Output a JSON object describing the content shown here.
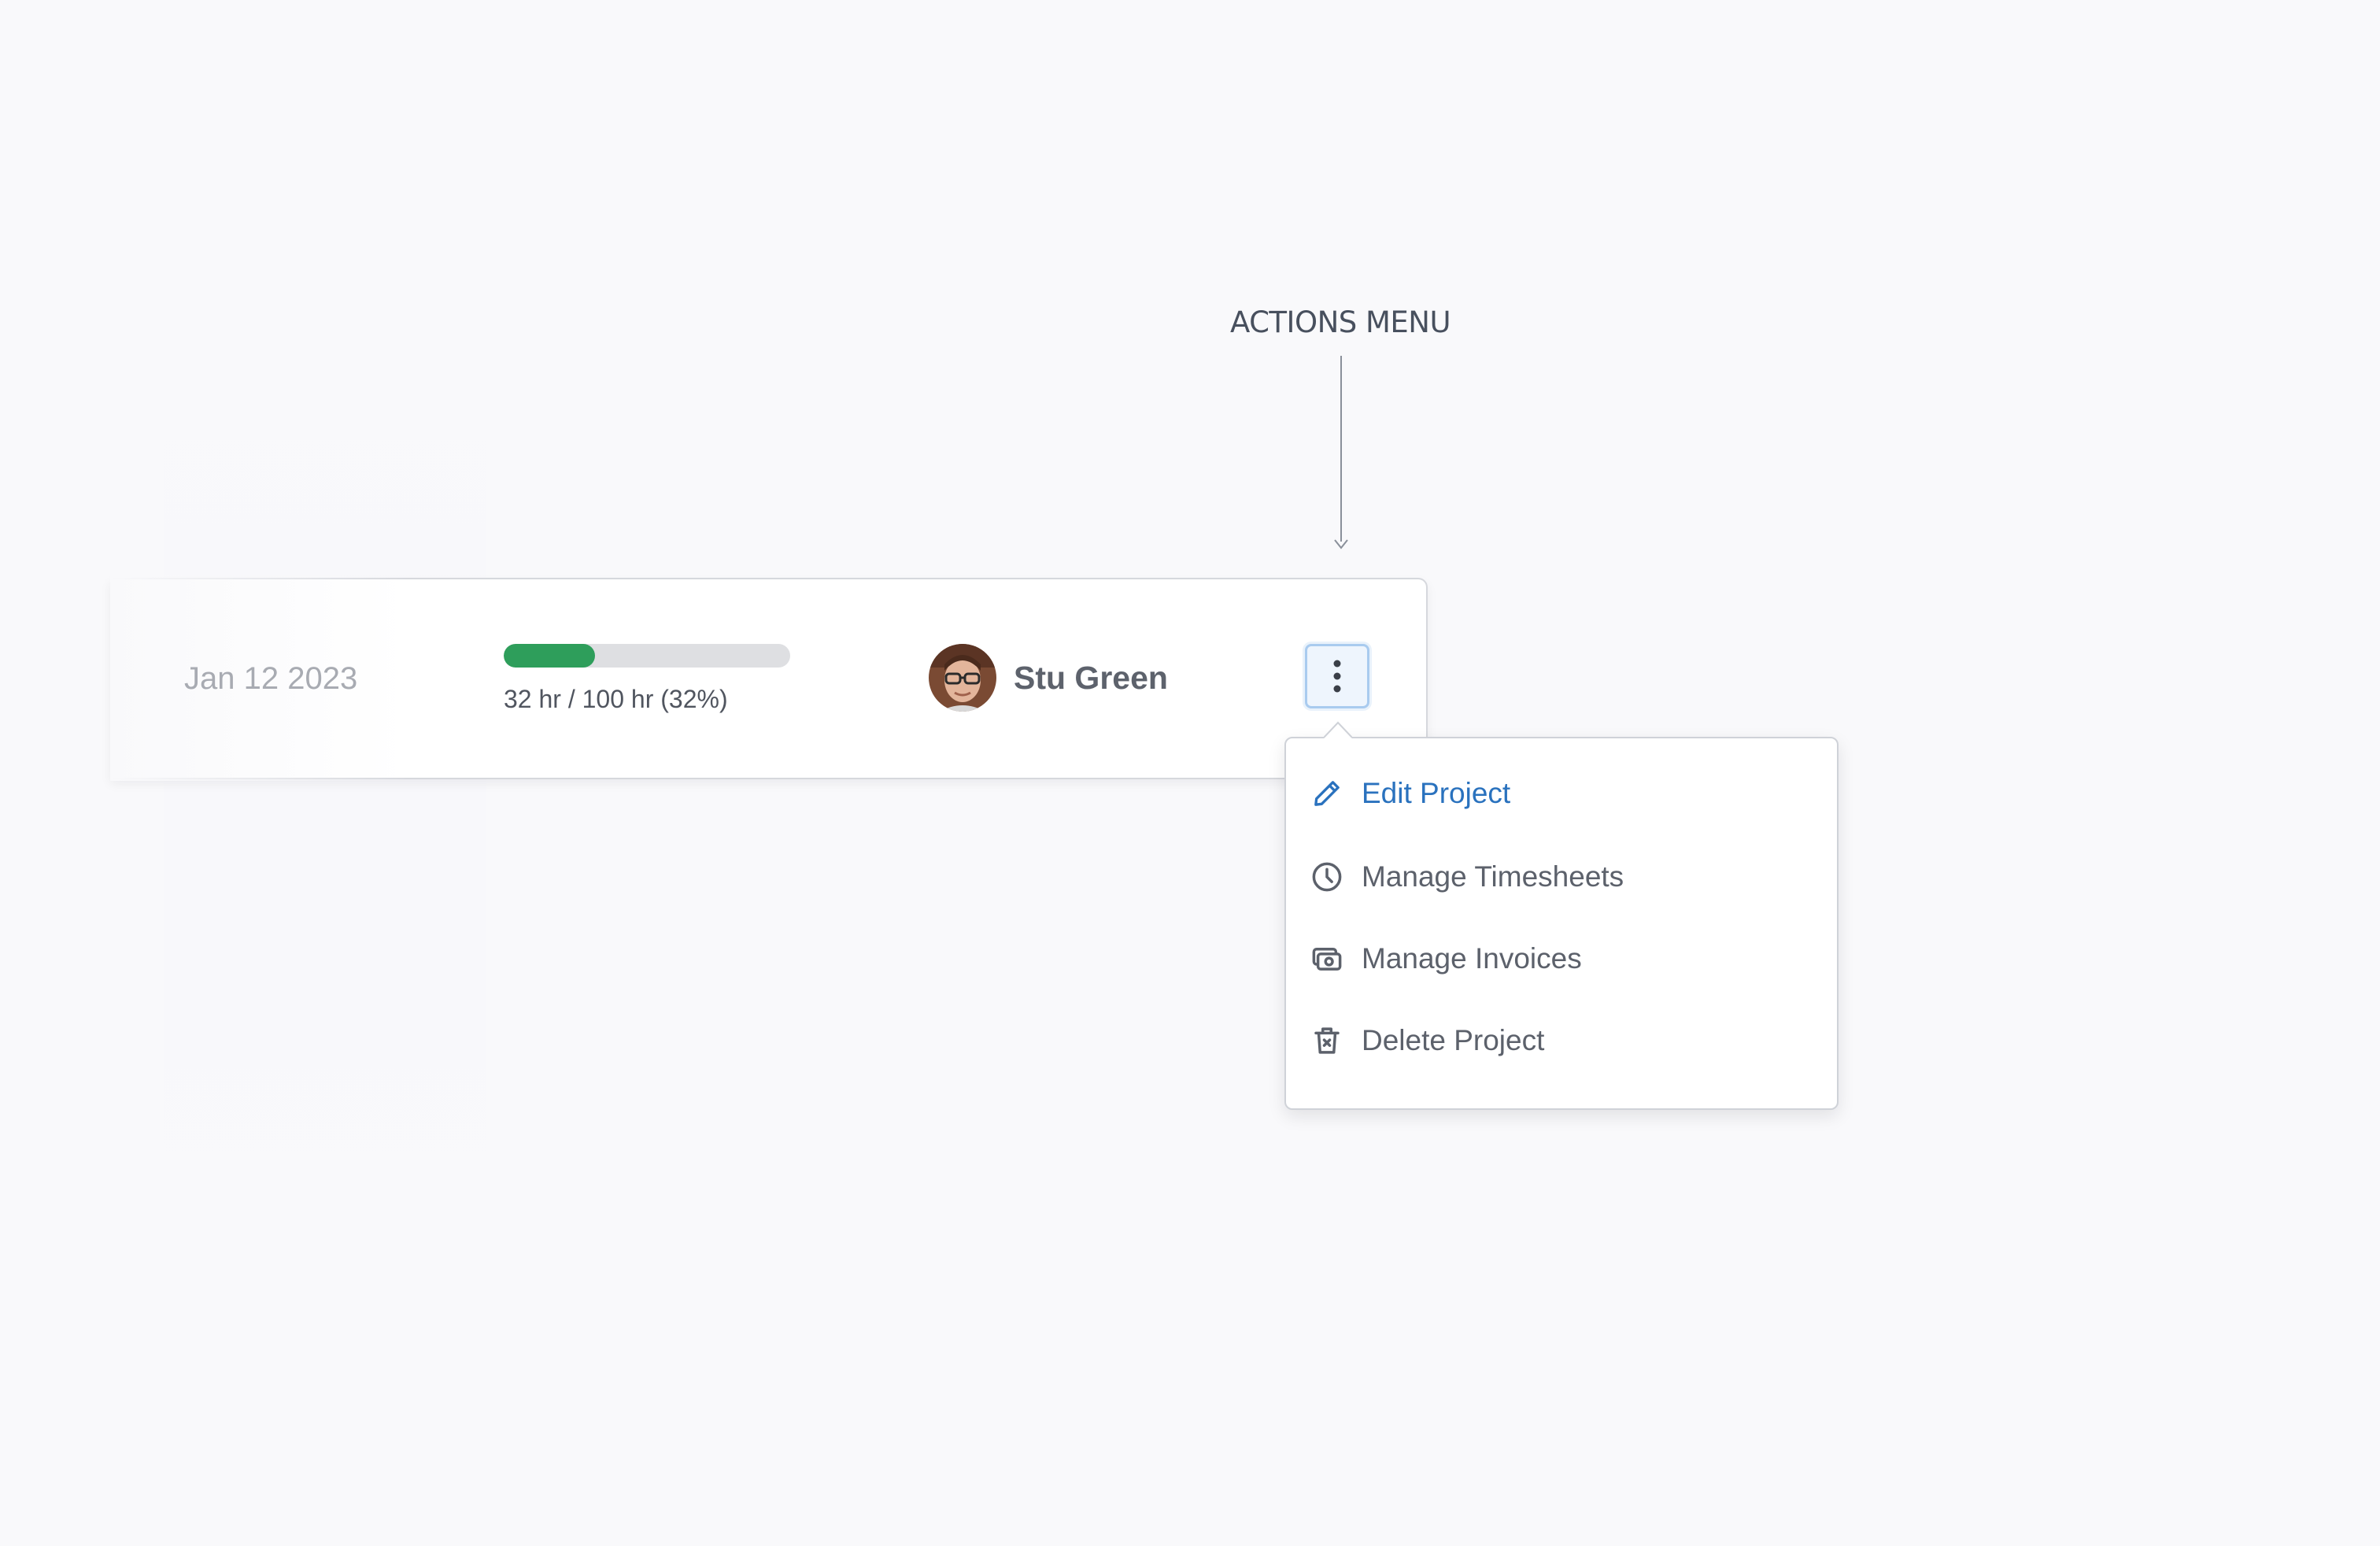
{
  "annotation": {
    "label": "ACTIONS MENU"
  },
  "row": {
    "date": "Jan 12 2023",
    "progress": {
      "hours_logged": 32,
      "hours_budget": 100,
      "percent": 32,
      "text": "32 hr / 100 hr (32%)"
    },
    "owner": {
      "name": "Stu Green",
      "avatar": "user-photo"
    },
    "actions_button_icon": "more-vertical-icon"
  },
  "actions_menu": {
    "items": [
      {
        "label": "Edit Project",
        "icon": "pencil-icon",
        "active": true
      },
      {
        "label": "Manage Timesheets",
        "icon": "clock-icon",
        "active": false
      },
      {
        "label": "Manage Invoices",
        "icon": "money-icon",
        "active": false
      },
      {
        "label": "Delete Project",
        "icon": "trash-icon",
        "active": false
      }
    ]
  },
  "colors": {
    "progress_fill": "#2e9e5b",
    "progress_track": "#dedfe2",
    "accent": "#2a72be",
    "button_border": "#a9cbef"
  }
}
